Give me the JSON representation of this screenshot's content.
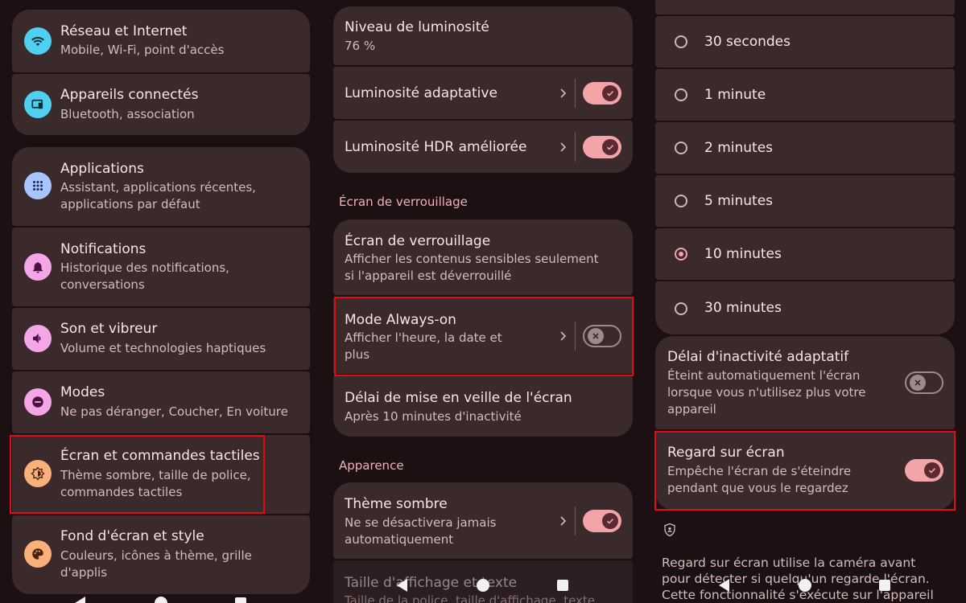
{
  "settings_list": {
    "items": [
      {
        "title": "Réseau et Internet",
        "subtitle": "Mobile, Wi-Fi, point d'accès",
        "icon": "wifi-icon",
        "icon_color": "#4fd0f0"
      },
      {
        "title": "Appareils connectés",
        "subtitle": "Bluetooth, association",
        "icon": "connected-devices-icon",
        "icon_color": "#4fd0f0"
      },
      {
        "title": "Applications",
        "subtitle": "Assistant, applications récentes, applications par défaut",
        "icon": "apps-grid-icon",
        "icon_color": "#a9c5ff"
      },
      {
        "title": "Notifications",
        "subtitle": "Historique des notifications, conversations",
        "icon": "bell-icon",
        "icon_color": "#f4a6e6"
      },
      {
        "title": "Son et vibreur",
        "subtitle": "Volume et technologies haptiques",
        "icon": "speaker-icon",
        "icon_color": "#f4a6e6"
      },
      {
        "title": "Modes",
        "subtitle": "Ne pas déranger, Coucher, En voiture",
        "icon": "do-not-disturb-icon",
        "icon_color": "#f4a6e6"
      },
      {
        "title": "Écran et commandes tactiles",
        "subtitle": "Thème sombre, taille de police, commandes tactiles",
        "icon": "brightness-icon",
        "icon_color": "#f9b07a"
      },
      {
        "title": "Fond d'écran et style",
        "subtitle": "Couleurs, icônes à thème, grille d'applis",
        "icon": "palette-icon",
        "icon_color": "#f9b07a"
      }
    ]
  },
  "display": {
    "brightness_title": "Niveau de luminosité",
    "brightness_value": "76 %",
    "adaptive_brightness": "Luminosité adaptative",
    "hdr_brightness": "Luminosité HDR améliorée",
    "lockscreen_section": "Écran de verrouillage",
    "lockscreen_title": "Écran de verrouillage",
    "lockscreen_sub": "Afficher les contenus sensibles seulement si l'appareil est déverrouillé",
    "aod_title": "Mode Always-on",
    "aod_sub": "Afficher l'heure, la date et plus",
    "sleep_title": "Délai de mise en veille de l'écran",
    "sleep_sub": "Après 10 minutes d'inactivité",
    "appearance_section": "Apparence",
    "dark_title": "Thème sombre",
    "dark_sub": "Ne se désactivera jamais automatiquement",
    "display_size_title": "Taille d'affichage et texte",
    "display_size_sub": "Taille de la police, taille d'affichage, texte"
  },
  "timeout": {
    "options": [
      "30 secondes",
      "1 minute",
      "2 minutes",
      "5 minutes",
      "10 minutes",
      "30 minutes"
    ],
    "selected": "10 minutes",
    "adaptive_title": "Délai d'inactivité adaptatif",
    "adaptive_sub": "Éteint automatiquement l'écran lorsque vous n'utilisez plus votre appareil",
    "attention_title": "Regard sur écran",
    "attention_sub": "Empêche l'écran de s'éteindre pendant que vous le regardez",
    "footnote": "Regard sur écran utilise la caméra avant pour détecter si quelqu'un regarde l'écran. Cette fonctionnalité s'exécute sur l'appareil"
  },
  "colors": {
    "accent": "#f2a4a9",
    "highlight": "#e10c14",
    "card": "#3a2a2c",
    "background": "#1c1012"
  }
}
